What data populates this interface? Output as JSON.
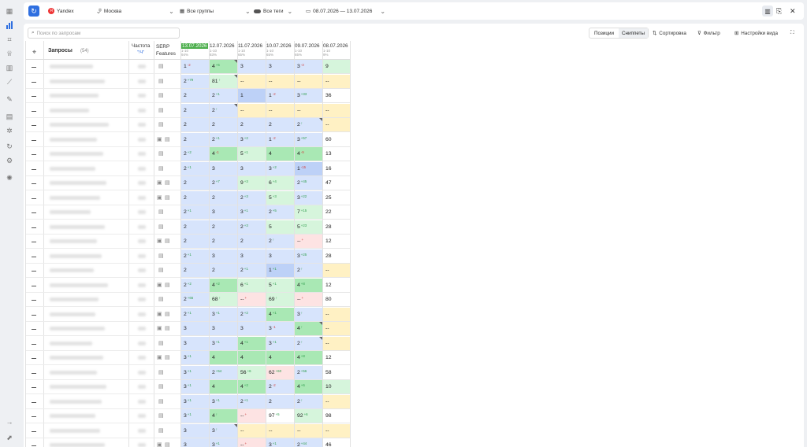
{
  "topbar": {
    "engine": "Yandex",
    "region": "Москва",
    "groups": "Все группы",
    "tags": "Все теги",
    "date_range": "08.07.2026 — 13.07.2026"
  },
  "toolbar": {
    "search_placeholder": "Поиск по запросам",
    "positions": "Позиции",
    "snippets": "Сниппеты",
    "sort": "Сортировка",
    "filter": "Фильтр",
    "view_settings": "Настройки вида"
  },
  "table": {
    "queries_label": "Запросы",
    "queries_count": "(54)",
    "freq_label": "Частота",
    "freq_sub": "\"!Ч\"",
    "serp_label": "SERP",
    "serp_label2": "Features",
    "dates": [
      {
        "date": "13.07.2026",
        "top": "1-10",
        "pct": "94%"
      },
      {
        "date": "12.07.2026",
        "top": "1-10",
        "pct": "83%"
      },
      {
        "date": "11.07.2026",
        "top": "1-10",
        "pct": "65%"
      },
      {
        "date": "10.07.2026",
        "top": "1-10",
        "pct": "65%"
      },
      {
        "date": "09.07.2026",
        "top": "1-10",
        "pct": "65%"
      },
      {
        "date": "08.07.2026",
        "top": "1-10",
        "pct": "9%"
      }
    ],
    "rows": [
      {
        "img": false,
        "cells": [
          [
            "1",
            "-2",
            "bl"
          ],
          [
            "4",
            "+5",
            "gr",
            1
          ],
          [
            "3",
            "",
            "bl"
          ],
          [
            "3",
            "",
            "bl"
          ],
          [
            "3",
            "-3",
            "bl"
          ],
          [
            "9",
            "",
            "lgr"
          ]
        ]
      },
      {
        "img": false,
        "cells": [
          [
            "2",
            "+79",
            "bl"
          ],
          [
            "81",
            "↑",
            "lgr",
            1
          ],
          [
            "--",
            "",
            "yl"
          ],
          [
            "--",
            "",
            "yl"
          ],
          [
            "--",
            "",
            "yl"
          ],
          [
            "--",
            "",
            "yl"
          ]
        ]
      },
      {
        "img": false,
        "cells": [
          [
            "2",
            "",
            "bl"
          ],
          [
            "2",
            "+1",
            "bl"
          ],
          [
            "1",
            "",
            "dblue"
          ],
          [
            "1",
            "-2",
            "bl"
          ],
          [
            "3",
            "+33",
            "bl"
          ],
          [
            "36",
            "",
            "wh"
          ]
        ]
      },
      {
        "img": false,
        "cells": [
          [
            "2",
            "",
            "bl"
          ],
          [
            "2",
            "↑",
            "bl",
            1
          ],
          [
            "--",
            "",
            "yl"
          ],
          [
            "--",
            "",
            "yl"
          ],
          [
            "--",
            "",
            "yl"
          ],
          [
            "--",
            "",
            "yl"
          ]
        ]
      },
      {
        "img": false,
        "cells": [
          [
            "2",
            "",
            "bl"
          ],
          [
            "2",
            "",
            "bl"
          ],
          [
            "2",
            "",
            "bl"
          ],
          [
            "2",
            "",
            "bl"
          ],
          [
            "2",
            "↑",
            "bl",
            1
          ],
          [
            "--",
            "",
            "yl"
          ]
        ]
      },
      {
        "img": true,
        "cells": [
          [
            "2",
            "",
            "bl"
          ],
          [
            "2",
            "+1",
            "bl"
          ],
          [
            "3",
            "+2",
            "bl"
          ],
          [
            "1",
            "-2",
            "bl"
          ],
          [
            "3",
            "+57",
            "bl"
          ],
          [
            "60",
            "",
            "wh"
          ]
        ]
      },
      {
        "img": false,
        "cells": [
          [
            "2",
            "+2",
            "bl"
          ],
          [
            "4",
            "-1",
            "gr"
          ],
          [
            "5",
            "+1",
            "lgr"
          ],
          [
            "4",
            "",
            "gr"
          ],
          [
            "4",
            "-9",
            "gr"
          ],
          [
            "13",
            "",
            "wh"
          ]
        ]
      },
      {
        "img": false,
        "cells": [
          [
            "2",
            "+1",
            "bl"
          ],
          [
            "3",
            "",
            "bl"
          ],
          [
            "3",
            "",
            "bl"
          ],
          [
            "3",
            "+2",
            "bl"
          ],
          [
            "1",
            "-15",
            "dblue"
          ],
          [
            "16",
            "",
            "wh"
          ]
        ]
      },
      {
        "img": true,
        "cells": [
          [
            "2",
            "",
            "bl"
          ],
          [
            "2",
            "+7",
            "bl"
          ],
          [
            "9",
            "+3",
            "lgr"
          ],
          [
            "6",
            "+4",
            "lgr"
          ],
          [
            "2",
            "+45",
            "bl"
          ],
          [
            "47",
            "",
            "wh"
          ]
        ]
      },
      {
        "img": true,
        "cells": [
          [
            "2",
            "",
            "bl"
          ],
          [
            "2",
            "",
            "bl"
          ],
          [
            "2",
            "+3",
            "bl"
          ],
          [
            "5",
            "+3",
            "lgr"
          ],
          [
            "3",
            "+22",
            "bl"
          ],
          [
            "25",
            "",
            "wh"
          ]
        ]
      },
      {
        "img": false,
        "cells": [
          [
            "2",
            "+1",
            "bl"
          ],
          [
            "3",
            "",
            "bl"
          ],
          [
            "3",
            "+1",
            "bl"
          ],
          [
            "2",
            "+5",
            "bl"
          ],
          [
            "7",
            "+15",
            "lgr"
          ],
          [
            "22",
            "",
            "wh"
          ]
        ]
      },
      {
        "img": false,
        "cells": [
          [
            "2",
            "",
            "bl"
          ],
          [
            "2",
            "",
            "bl"
          ],
          [
            "2",
            "+3",
            "bl"
          ],
          [
            "5",
            "",
            "lgr"
          ],
          [
            "5",
            "+23",
            "lgr"
          ],
          [
            "28",
            "",
            "wh"
          ]
        ]
      },
      {
        "img": true,
        "cells": [
          [
            "2",
            "",
            "bl"
          ],
          [
            "2",
            "",
            "bl"
          ],
          [
            "2",
            "",
            "bl"
          ],
          [
            "2",
            "↑",
            "bl"
          ],
          [
            "--",
            "+",
            "pk"
          ],
          [
            "12",
            "",
            "wh"
          ]
        ]
      },
      {
        "img": false,
        "cells": [
          [
            "2",
            "+1",
            "bl"
          ],
          [
            "3",
            "",
            "bl"
          ],
          [
            "3",
            "",
            "bl"
          ],
          [
            "3",
            "",
            "bl"
          ],
          [
            "3",
            "+25",
            "bl"
          ],
          [
            "28",
            "",
            "wh"
          ]
        ]
      },
      {
        "img": false,
        "cells": [
          [
            "2",
            "",
            "bl"
          ],
          [
            "2",
            "",
            "bl"
          ],
          [
            "2",
            "+1",
            "bl"
          ],
          [
            "1",
            "+1",
            "dblue"
          ],
          [
            "2",
            "↑",
            "bl"
          ],
          [
            "--",
            "",
            "yl"
          ]
        ]
      },
      {
        "img": true,
        "cells": [
          [
            "2",
            "+2",
            "bl"
          ],
          [
            "4",
            "+2",
            "gr"
          ],
          [
            "6",
            "+1",
            "lgr"
          ],
          [
            "5",
            "+1",
            "lgr"
          ],
          [
            "4",
            "+8",
            "gr"
          ],
          [
            "12",
            "",
            "wh"
          ]
        ]
      },
      {
        "img": false,
        "cells": [
          [
            "2",
            "+66",
            "bl"
          ],
          [
            "68",
            "↑",
            "lgr"
          ],
          [
            "--",
            "+",
            "pk"
          ],
          [
            "69",
            "↑",
            "lgr"
          ],
          [
            "--",
            "+",
            "pk"
          ],
          [
            "80",
            "",
            "wh"
          ]
        ]
      },
      {
        "img": true,
        "cells": [
          [
            "2",
            "+1",
            "bl"
          ],
          [
            "3",
            "+1",
            "bl"
          ],
          [
            "2",
            "+2",
            "bl"
          ],
          [
            "4",
            "+1",
            "gr"
          ],
          [
            "3",
            "↑",
            "bl"
          ],
          [
            "--",
            "",
            "yl"
          ]
        ]
      },
      {
        "img": true,
        "cells": [
          [
            "3",
            "",
            "bl"
          ],
          [
            "3",
            "",
            "bl"
          ],
          [
            "3",
            "",
            "bl"
          ],
          [
            "3",
            "-1",
            "bl"
          ],
          [
            "4",
            "↑",
            "gr",
            1
          ],
          [
            "--",
            "",
            "yl"
          ]
        ]
      },
      {
        "img": false,
        "cells": [
          [
            "3",
            "",
            "bl"
          ],
          [
            "3",
            "+1",
            "bl"
          ],
          [
            "4",
            "+1",
            "gr"
          ],
          [
            "3",
            "+1",
            "bl"
          ],
          [
            "2",
            "↑",
            "bl",
            1
          ],
          [
            "--",
            "",
            "yl"
          ]
        ]
      },
      {
        "img": true,
        "cells": [
          [
            "3",
            "+1",
            "bl"
          ],
          [
            "4",
            "",
            "gr"
          ],
          [
            "4",
            "",
            "gr"
          ],
          [
            "4",
            "",
            "gr"
          ],
          [
            "4",
            "+8",
            "gr"
          ],
          [
            "12",
            "",
            "wh"
          ]
        ]
      },
      {
        "img": false,
        "cells": [
          [
            "3",
            "+1",
            "bl"
          ],
          [
            "2",
            "+54",
            "bl"
          ],
          [
            "56",
            "+6",
            "lgr"
          ],
          [
            "62",
            "+60",
            "pk"
          ],
          [
            "2",
            "+56",
            "bl"
          ],
          [
            "58",
            "",
            "wh"
          ]
        ]
      },
      {
        "img": false,
        "cells": [
          [
            "3",
            "+1",
            "bl"
          ],
          [
            "4",
            "",
            "gr"
          ],
          [
            "4",
            "+2",
            "gr"
          ],
          [
            "2",
            "-2",
            "bl"
          ],
          [
            "4",
            "+6",
            "gr"
          ],
          [
            "10",
            "",
            "lgr"
          ]
        ]
      },
      {
        "img": false,
        "cells": [
          [
            "3",
            "+1",
            "bl"
          ],
          [
            "3",
            "+1",
            "bl"
          ],
          [
            "2",
            "+1",
            "bl"
          ],
          [
            "2",
            "",
            "bl"
          ],
          [
            "2",
            "↑",
            "bl"
          ],
          [
            "--",
            "",
            "yl"
          ]
        ]
      },
      {
        "img": false,
        "cells": [
          [
            "3",
            "+1",
            "bl"
          ],
          [
            "4",
            "↑",
            "gr"
          ],
          [
            "--",
            "+",
            "pk"
          ],
          [
            "97",
            "+5",
            "wh"
          ],
          [
            "92",
            "+6",
            "lgr"
          ],
          [
            "98",
            "",
            "wh"
          ]
        ]
      },
      {
        "img": false,
        "cells": [
          [
            "3",
            "",
            "bl"
          ],
          [
            "3",
            "↑",
            "bl",
            1
          ],
          [
            "--",
            "",
            "yl"
          ],
          [
            "--",
            "",
            "yl"
          ],
          [
            "--",
            "",
            "yl"
          ],
          [
            "--",
            "",
            "yl"
          ]
        ]
      },
      {
        "img": true,
        "cells": [
          [
            "3",
            "",
            "bl"
          ],
          [
            "3",
            "+1",
            "bl"
          ],
          [
            "--",
            "+",
            "pk"
          ],
          [
            "3",
            "+1",
            "bl"
          ],
          [
            "2",
            "+44",
            "bl"
          ],
          [
            "46",
            "",
            "wh"
          ]
        ]
      }
    ]
  }
}
